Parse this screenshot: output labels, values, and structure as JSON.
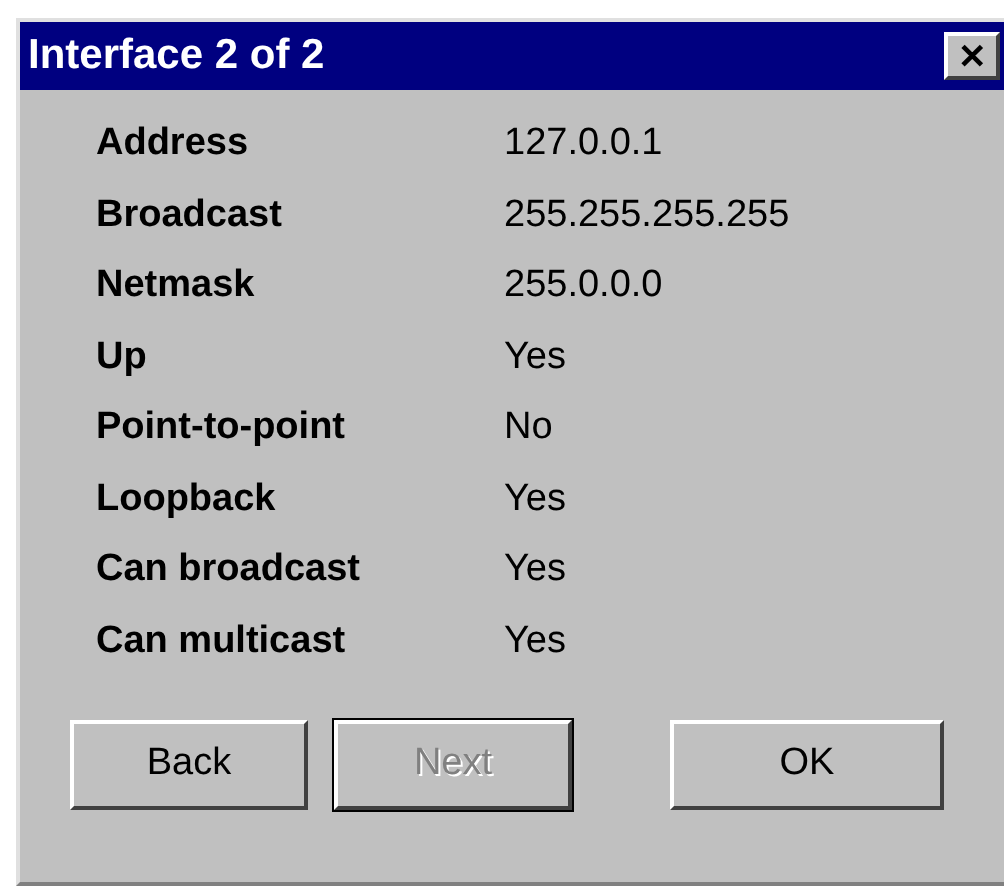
{
  "window": {
    "title": "Interface 2 of 2",
    "close": "✕"
  },
  "fields": [
    {
      "label": "Address",
      "value": "127.0.0.1"
    },
    {
      "label": "Broadcast",
      "value": "255.255.255.255"
    },
    {
      "label": "Netmask",
      "value": "255.0.0.0"
    },
    {
      "label": "Up",
      "value": "Yes"
    },
    {
      "label": "Point-to-point",
      "value": "No"
    },
    {
      "label": "Loopback",
      "value": "Yes"
    },
    {
      "label": "Can broadcast",
      "value": "Yes"
    },
    {
      "label": "Can multicast",
      "value": "Yes"
    }
  ],
  "buttons": [
    {
      "label": "Back",
      "disabled": false,
      "default": false
    },
    {
      "label": "Next",
      "disabled": true,
      "default": true
    },
    {
      "label": "OK",
      "disabled": false,
      "default": false
    }
  ]
}
